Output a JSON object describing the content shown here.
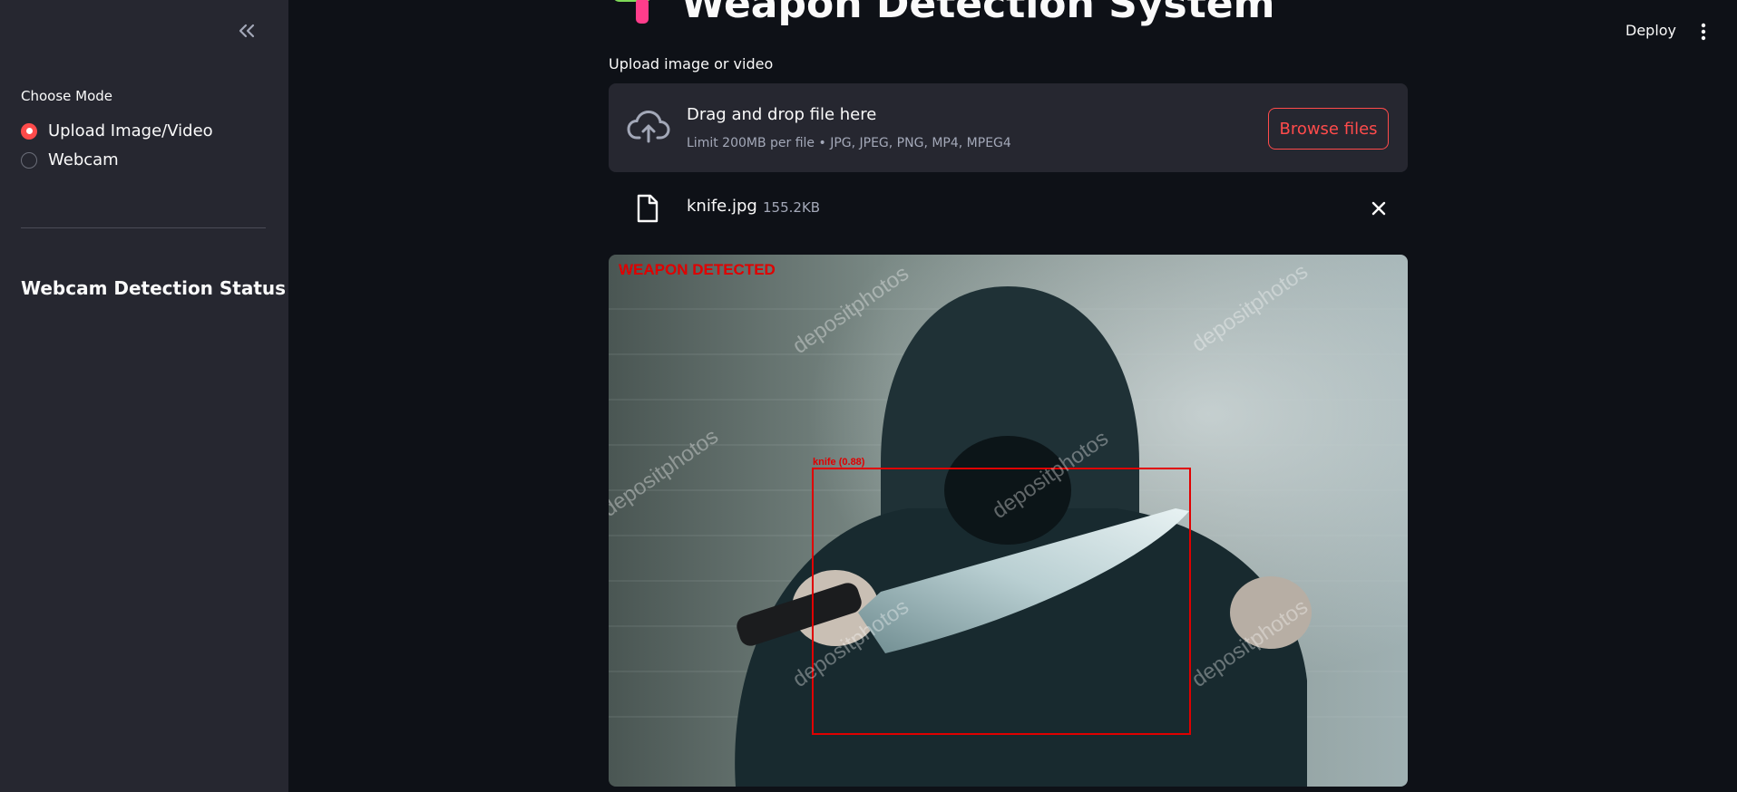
{
  "sidebar": {
    "mode_label": "Choose Mode",
    "modes": [
      {
        "label": "Upload Image/Video",
        "selected": true
      },
      {
        "label": "Webcam",
        "selected": false
      }
    ],
    "status_heading": "Webcam Detection Status"
  },
  "header": {
    "title": "Weapon Detection System",
    "title_icon": "water-gun-emoji",
    "deploy_label": "Deploy"
  },
  "uploader": {
    "label": "Upload image or video",
    "drop_title": "Drag and drop file here",
    "drop_limit": "Limit 200MB per file • JPG, JPEG, PNG, MP4, MPEG4",
    "browse_label": "Browse files",
    "file": {
      "name": "knife.jpg",
      "size": "155.2KB"
    }
  },
  "result": {
    "banner": "WEAPON DETECTED",
    "detection_label": "knife (0.88)",
    "watermark": "depositphotos"
  },
  "colors": {
    "accent": "#ff4b4b",
    "background": "#0e1117",
    "sidebar": "#262730",
    "detection": "#e00000"
  }
}
